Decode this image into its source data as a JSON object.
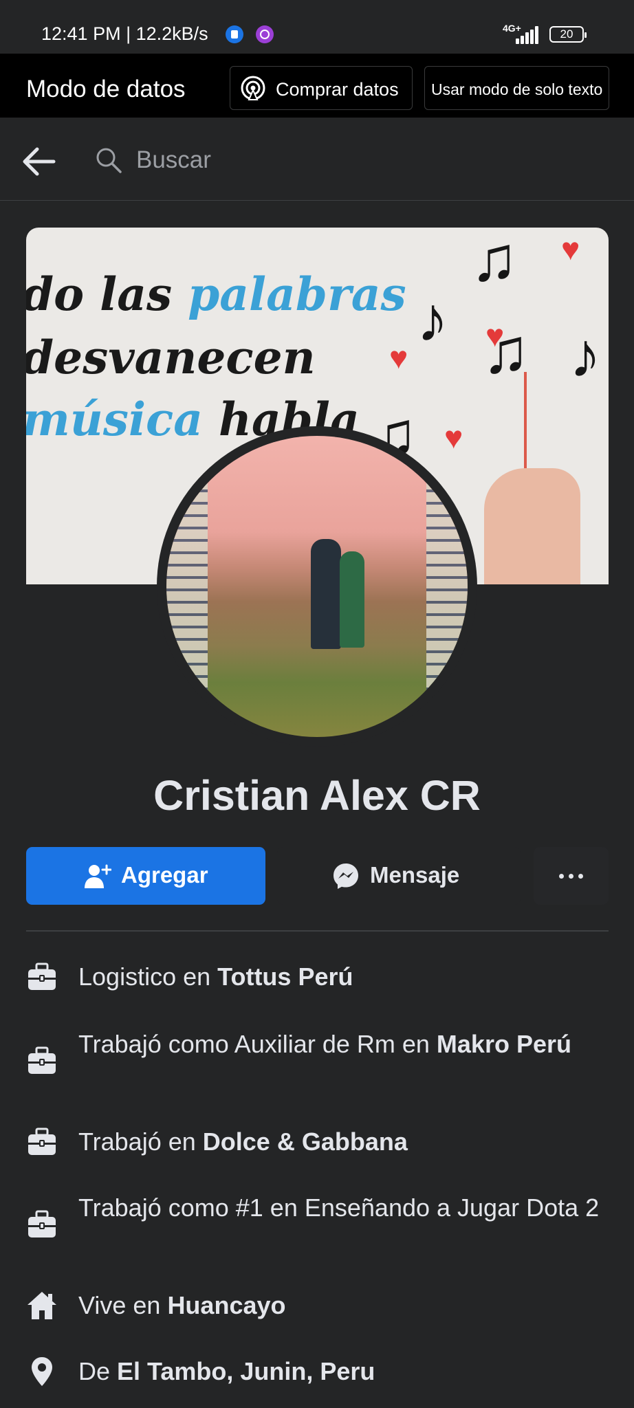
{
  "status_bar": {
    "time": "12:41 PM | 12.2kB/s",
    "network": "4G+",
    "battery": "20"
  },
  "data_mode": {
    "title": "Modo de datos",
    "buy_label": "Comprar datos",
    "text_only_label": "Usar modo de solo texto"
  },
  "search": {
    "placeholder": "Buscar"
  },
  "cover": {
    "line1_a": "do las ",
    "line1_b": "palabras",
    "line2": "desvanecen",
    "line3_a": "música",
    "line3_b": " habla"
  },
  "profile": {
    "name": "Cristian Alex CR",
    "add_label": "Agregar",
    "message_label": "Mensaje"
  },
  "details": [
    {
      "icon": "briefcase-icon",
      "prefix": "Logistico en ",
      "bold": "Tottus Perú"
    },
    {
      "icon": "briefcase-icon",
      "prefix": "Trabajó como Auxiliar de Rm en ",
      "bold": "Makro Perú"
    },
    {
      "icon": "briefcase-icon",
      "prefix": "Trabajó en ",
      "bold": "Dolce & Gabbana"
    },
    {
      "icon": "briefcase-icon",
      "prefix": "Trabajó como #1 en Enseñando a Jugar Dota 2",
      "bold": ""
    },
    {
      "icon": "home-icon",
      "prefix": "Vive en ",
      "bold": "Huancayo"
    },
    {
      "icon": "location-pin-icon",
      "prefix": "De ",
      "bold": "El Tambo, Junin, Peru"
    }
  ],
  "colors": {
    "background": "#242526",
    "accent": "#1b74e4",
    "text": "#e4e6eb"
  }
}
